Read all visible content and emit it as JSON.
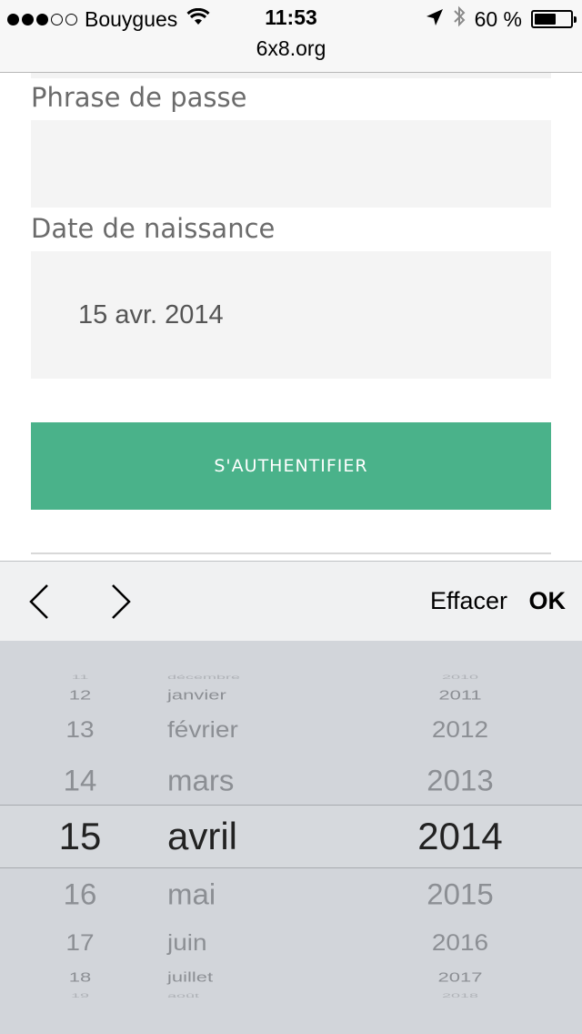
{
  "status_bar": {
    "carrier": "Bouygues",
    "time": "11:53",
    "url": "6x8.org",
    "battery": "60 %",
    "battery_level": 0.6,
    "signal_bars": 3,
    "icons": [
      "wifi-icon",
      "location-arrow-icon",
      "bluetooth-icon",
      "battery-icon"
    ]
  },
  "form": {
    "passphrase_label": "Phrase de passe",
    "passphrase_value": "",
    "birthdate_label": "Date de naissance",
    "birthdate_value": "15 avr. 2014",
    "submit_label": "S'AUTHENTIFIER",
    "accent_color": "#4ab28a"
  },
  "toolbar": {
    "prev_icon": "chevron-left-icon",
    "next_icon": "chevron-right-icon",
    "clear_label": "Effacer",
    "ok_label": "OK"
  },
  "picker": {
    "days": [
      "11",
      "12",
      "13",
      "14",
      "15",
      "16",
      "17",
      "18",
      "19"
    ],
    "months": [
      "décembre",
      "janvier",
      "février",
      "mars",
      "avril",
      "mai",
      "juin",
      "juillet",
      "août"
    ],
    "years": [
      "2010",
      "2011",
      "2012",
      "2013",
      "2014",
      "2015",
      "2016",
      "2017",
      "2018"
    ],
    "selected": {
      "day": "15",
      "month": "avril",
      "year": "2014"
    }
  }
}
